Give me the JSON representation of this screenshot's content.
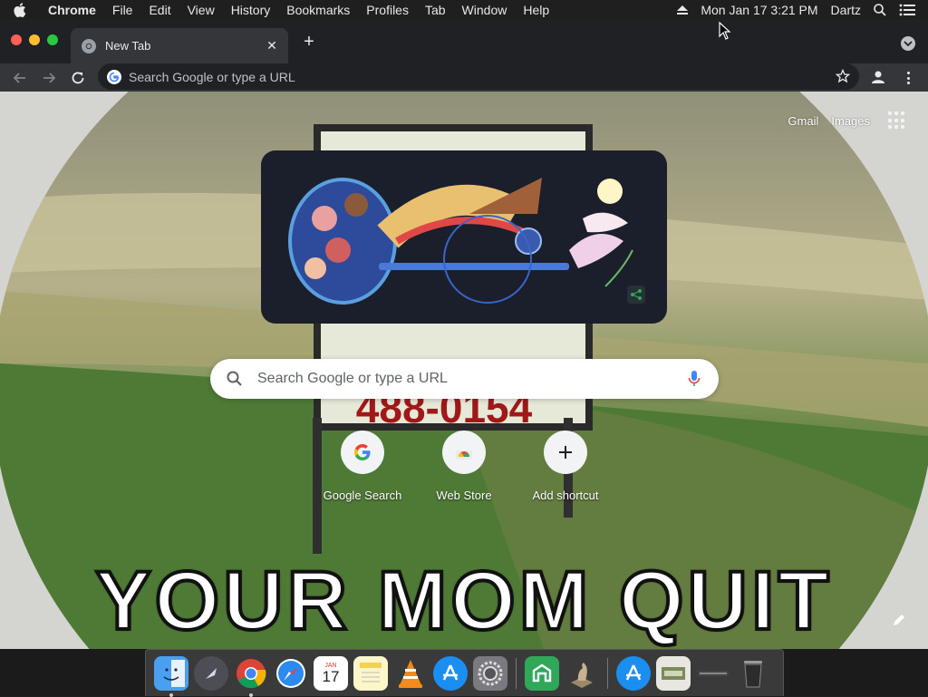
{
  "menubar": {
    "apple_icon": "apple-icon",
    "items": [
      "Chrome",
      "File",
      "Edit",
      "View",
      "History",
      "Bookmarks",
      "Profiles",
      "Tab",
      "Window",
      "Help"
    ],
    "datetime": "Mon Jan 17  3:21 PM",
    "user": "Dartz"
  },
  "browser": {
    "tab_title": "New Tab",
    "omnibox_placeholder": "Search Google or type a URL"
  },
  "ntp": {
    "gmail": "Gmail",
    "images": "Images",
    "search_placeholder": "Search Google or type a URL",
    "shortcuts": [
      {
        "label": "Google Search",
        "icon": "google-g-icon"
      },
      {
        "label": "Web Store",
        "icon": "web-store-icon"
      },
      {
        "label": "Add shortcut",
        "icon": "plus-icon"
      }
    ],
    "background_text": "YOUR MOM QUIT",
    "background_sign_number": "488-0154"
  },
  "dock": {
    "apps": [
      "Finder",
      "Launchpad",
      "Chrome",
      "Safari",
      "Calendar",
      "Notes",
      "VLC",
      "App Store",
      "System Preferences",
      "Utility",
      "Chess",
      "App Store Downloads",
      "Document",
      "Screen",
      "Trash"
    ],
    "calendar_month": "JAN",
    "calendar_day": "17"
  },
  "colors": {
    "chrome_dark": "#202124",
    "toolbar": "#35363a",
    "accent_blue": "#4285f4"
  }
}
